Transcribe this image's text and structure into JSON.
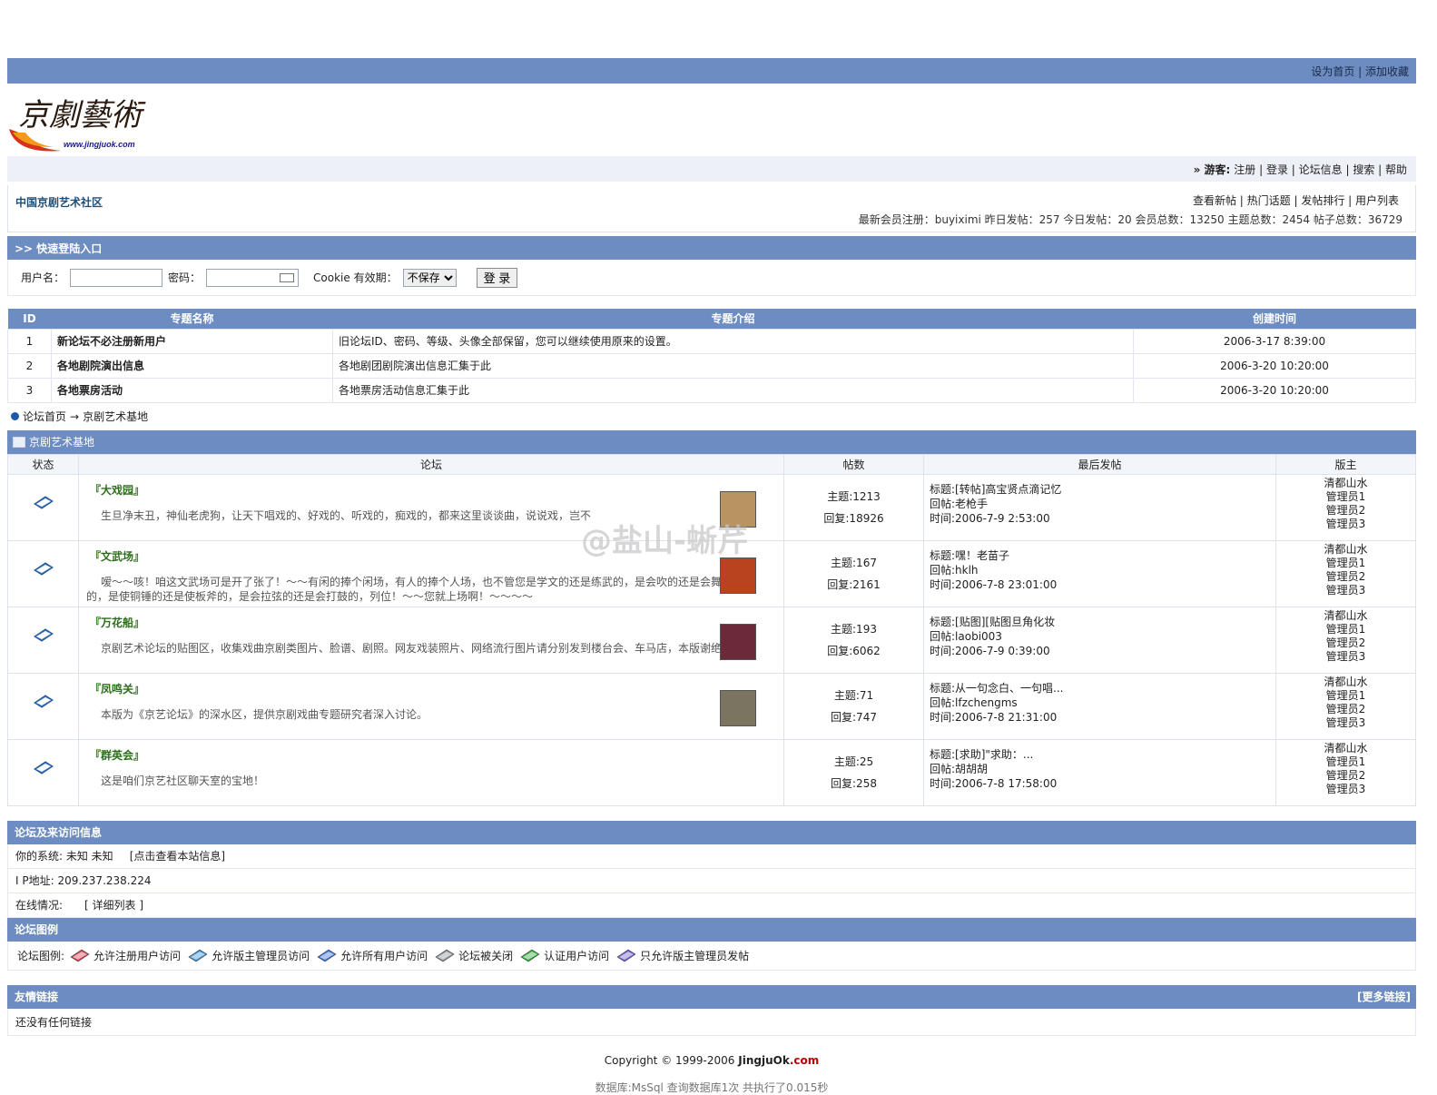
{
  "top": {
    "links": "设为首页 | 添加收藏"
  },
  "logo": {
    "text": "京劇藝術",
    "url": "www.jingjuok.com"
  },
  "userbar": {
    "guest_label": "» 游客:",
    "links": "注册 |  登录 | 论坛信息 | 搜索 | 帮助"
  },
  "info": {
    "site_name": "中国京剧艺术社区",
    "links": "查看新帖 | 热门话题 | 发帖排行 | 用户列表",
    "stats": "最新会员注册：buyiximi 昨日发帖：257 今日发帖：20 会员总数：13250 主题总数：2454 帖子总数：36729"
  },
  "login": {
    "title": ">> 快速登陆入口",
    "username_label": "用户名：",
    "password_label": "密码：",
    "cookie_label": "Cookie 有效期：",
    "cookie_value": "不保存",
    "submit": "登 录"
  },
  "topics": {
    "headers": [
      "ID",
      "专题名称",
      "专题介绍",
      "创建时间"
    ],
    "rows": [
      {
        "id": "1",
        "name": "新论坛不必注册新用户",
        "desc": "旧论坛ID、密码、等级、头像全部保留，您可以继续使用原来的设置。",
        "time": "2006-3-17 8:39:00"
      },
      {
        "id": "2",
        "name": "各地剧院演出信息",
        "desc": "各地剧团剧院演出信息汇集于此",
        "time": "2006-3-20 10:20:00"
      },
      {
        "id": "3",
        "name": "各地票房活动",
        "desc": "各地票房活动信息汇集于此",
        "time": "2006-3-20 10:20:00"
      }
    ]
  },
  "breadcrumb": {
    "home": "论坛首页",
    "arrow": "→",
    "current": "京剧艺术基地"
  },
  "forums": {
    "title": "京剧艺术基地",
    "headers": [
      "状态",
      "论坛",
      "帖数",
      "最后发帖",
      "版主"
    ],
    "rows": [
      {
        "name": "『大戏园』",
        "desc": "生旦净末丑，神仙老虎狗，让天下唱戏的、好戏的、听戏的，痴戏的，都来这里谈谈曲，说说戏，岂不",
        "topics": "主题:1213",
        "replies": "回复:18926",
        "last_title": "标题:[转帖]高宝贤点滴记忆",
        "last_reply": "回帖:老枪手",
        "last_time": "时间:2006-7-9 2:53:00",
        "img_color": "#b89460"
      },
      {
        "name": "『文武场』",
        "desc": "嗳～～咳！咱这文武场可是开了张了！～～有闲的捧个闲场，有人的捧个人场，也不管您是学文的还是练武的，是会吹的还是会舞的，是使铜锤的还是使板斧的，是会拉弦的还是会打鼓的，列位！～～您就上场啊！～～～～",
        "topics": "主题:167",
        "replies": "回复:2161",
        "last_title": "标题:嘿！老苗子",
        "last_reply": "回帖:hklh",
        "last_time": "时间:2006-7-8 23:01:00",
        "img_color": "#b8431e"
      },
      {
        "name": "『万花船』",
        "desc": "京剧艺术论坛的贴图区，收集戏曲京剧类图片、脸谱、剧照。网友戏装照片、网络流行图片请分别发到楼台会、车马店，本版谢绝。",
        "topics": "主题:193",
        "replies": "回复:6062",
        "last_title": "标题:[贴图][贴图旦角化妆",
        "last_reply": "回帖:laobi003",
        "last_time": "时间:2006-7-9 0:39:00",
        "img_color": "#6b2a3a"
      },
      {
        "name": "『凤鸣关』",
        "desc": "本版为《京艺论坛》的深水区，提供京剧戏曲专题研究者深入讨论。",
        "topics": "主题:71",
        "replies": "回复:747",
        "last_title": "标题:从一句念白、一句唱...",
        "last_reply": "回帖:lfzchengms",
        "last_time": "时间:2006-7-8 21:31:00",
        "img_color": "#7a7460"
      },
      {
        "name": "『群英会』",
        "desc": "这是咱们京艺社区聊天室的宝地！",
        "topics": "主题:25",
        "replies": "回复:258",
        "last_title": "标题:[求助]\"求助：...",
        "last_reply": "回帖:胡胡胡",
        "last_time": "时间:2006-7-8 17:58:00",
        "img_color": ""
      }
    ],
    "mods": [
      "清都山水",
      "管理员1",
      "管理员2",
      "管理员3"
    ]
  },
  "visit": {
    "title": "论坛及来访问信息",
    "system": "你的系统: 未知 未知",
    "system_link": "[点击查看本站信息]",
    "ip": "I P地址: 209.237.238.224",
    "online": "在线情况:",
    "online_link": "[ 详细列表 ]"
  },
  "legend": {
    "title": "论坛图例",
    "label": "论坛图例:",
    "items": [
      {
        "text": "允许注册用户访问",
        "color": "#d23a4b"
      },
      {
        "text": "允许版主管理员访问",
        "color": "#3a8fd2"
      },
      {
        "text": "允许所有用户访问",
        "color": "#3a6fd2"
      },
      {
        "text": "论坛被关闭",
        "color": "#8b8f96"
      },
      {
        "text": "认证用户访问",
        "color": "#2ea83a"
      },
      {
        "text": "只允许版主管理员发帖",
        "color": "#6b5cc8"
      }
    ]
  },
  "links": {
    "title": "友情链接",
    "more": "[更多链接]",
    "empty": "还没有任何链接"
  },
  "footer": {
    "copyright": "Copyright © 1999-2006",
    "brand": "JingjuOk",
    "com": ".com",
    "db": "数据库:MsSql 查询数据库1次 共执行了0.015秒"
  },
  "watermark": "@盐山-蜥芹"
}
